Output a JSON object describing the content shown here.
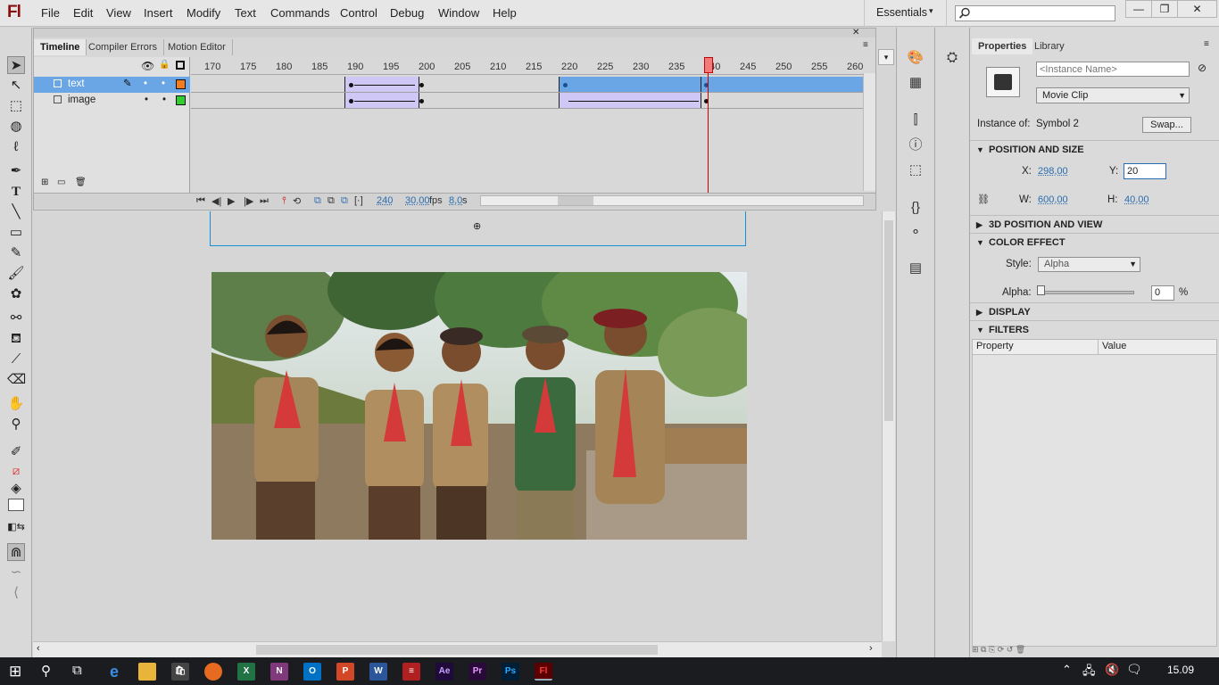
{
  "app": {
    "logo": "Fl"
  },
  "menu": [
    "File",
    "Edit",
    "View",
    "Insert",
    "Modify",
    "Text",
    "Commands",
    "Control",
    "Debug",
    "Window",
    "Help"
  ],
  "workspace": {
    "label": "Essentials",
    "caret": "▾"
  },
  "window_controls": {
    "minimize": "—",
    "restore": "❐",
    "close": "✕"
  },
  "timeline": {
    "tabs": [
      "Timeline",
      "Compiler Errors",
      "Motion Editor"
    ],
    "ruler": [
      "170",
      "175",
      "180",
      "185",
      "190",
      "195",
      "200",
      "205",
      "210",
      "215",
      "220",
      "225",
      "230",
      "235",
      "240",
      "245",
      "250",
      "255",
      "260"
    ],
    "layers": [
      {
        "name": "text",
        "color": "#f47c20"
      },
      {
        "name": "image",
        "color": "#33cc33"
      }
    ],
    "current_frame": "240",
    "fps": "30,00",
    "fps_unit": "fps",
    "time": "8,0",
    "time_unit": "s"
  },
  "properties": {
    "tabs": [
      "Properties",
      "Library"
    ],
    "instance_name_placeholder": "<Instance Name>",
    "symbol_type": "Movie Clip",
    "instance_of_label": "Instance of:",
    "instance_of_value": "Symbol 2",
    "swap_label": "Swap...",
    "sections": {
      "position": "POSITION AND SIZE",
      "view3d": "3D POSITION AND VIEW",
      "color": "COLOR EFFECT",
      "display": "DISPLAY",
      "filters": "FILTERS"
    },
    "x_label": "X:",
    "x_value": "298,00",
    "y_label": "Y:",
    "y_value": "20",
    "w_label": "W:",
    "w_value": "600,00",
    "h_label": "H:",
    "h_value": "40,00",
    "style_label": "Style:",
    "style_value": "Alpha",
    "alpha_label": "Alpha:",
    "alpha_value": "0",
    "alpha_unit": "%",
    "filters_cols": [
      "Property",
      "Value"
    ]
  },
  "taskbar": {
    "time": "15.09"
  }
}
